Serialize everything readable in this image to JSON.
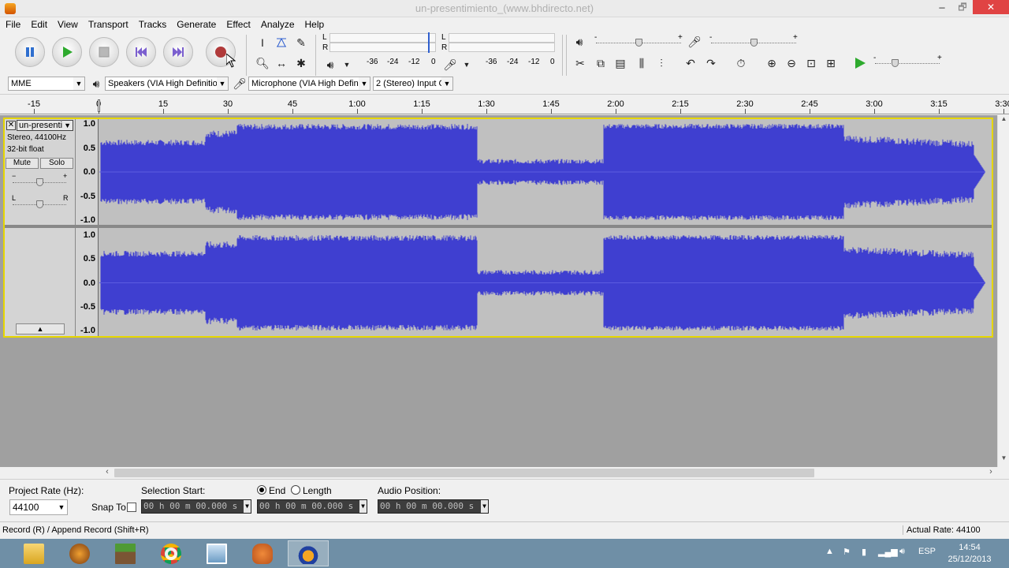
{
  "window": {
    "title": "un-presentimiento_(www.bhdirecto.net)",
    "minimize": "🗕",
    "maximize": "🗗",
    "close": "✕"
  },
  "menu": [
    "File",
    "Edit",
    "View",
    "Transport",
    "Tracks",
    "Generate",
    "Effect",
    "Analyze",
    "Help"
  ],
  "transport": {
    "pause": "pause-icon",
    "play": "play-icon",
    "stop": "stop-icon",
    "skip_start": "skip-to-start-icon",
    "skip_end": "skip-to-end-icon",
    "record": "record-icon"
  },
  "meters": {
    "playback": {
      "L": "L",
      "R": "R",
      "scale": [
        "-36",
        "-24",
        "-12",
        "0"
      ]
    },
    "record": {
      "L": "L",
      "R": "R",
      "scale": [
        "-36",
        "-24",
        "-12",
        "0"
      ]
    }
  },
  "mixer": {
    "output_volume": 0.5,
    "input_volume": 0.5,
    "play_speed": 0.3
  },
  "device": {
    "host": "MME",
    "playback_device": "Speakers (VIA High Definition A",
    "recording_device": "Microphone (VIA High Definitio",
    "channels": "2 (Stereo) Input C"
  },
  "ruler": {
    "labels": [
      "-15",
      "0",
      "15",
      "30",
      "45",
      "1:00",
      "1:15",
      "1:30",
      "1:45",
      "2:00",
      "2:15",
      "2:30",
      "2:45",
      "3:00",
      "3:15",
      "3:30"
    ],
    "values_seconds": [
      -15,
      0,
      15,
      30,
      45,
      60,
      75,
      90,
      105,
      120,
      135,
      150,
      165,
      180,
      195,
      210
    ]
  },
  "track": {
    "name": "un-presenti",
    "format": "Stereo, 44100Hz",
    "bit_depth": "32-bit float",
    "mute": "Mute",
    "solo": "Solo",
    "gain_minus": "−",
    "gain_plus": "+",
    "pan_left": "L",
    "pan_right": "R",
    "collapse": "▲",
    "gain_level": 0.5,
    "pan_level": 0.5,
    "amplitude_labels": [
      "1.0",
      "0.5",
      "0.0",
      "-0.5",
      "-1.0"
    ],
    "waveform_color": "#3f3fd0",
    "selection_border_color": "#e6d600"
  },
  "selection_toolbar": {
    "project_rate_label": "Project Rate (Hz):",
    "project_rate": "44100",
    "snap_to": "Snap To",
    "selection_start_label": "Selection Start:",
    "end_label": "End",
    "length_label": "Length",
    "audio_position_label": "Audio Position:",
    "start_time": "00 h 00 m 00.000 s",
    "end_time": "00 h 00 m 00.000 s",
    "audio_position": "00 h 00 m 00.000 s",
    "end_selected": true
  },
  "status": {
    "left": "Record (R) / Append Record (Shift+R)",
    "right": "Actual Rate: 44100"
  },
  "taskbar": {
    "apps": [
      "file-explorer-icon",
      "media-player-icon",
      "minecraft-icon",
      "chrome-icon",
      "image-viewer-icon",
      "glove-app-icon",
      "audacity-icon"
    ],
    "tray_lang": "ESP",
    "time": "14:54",
    "date": "25/12/2013"
  }
}
